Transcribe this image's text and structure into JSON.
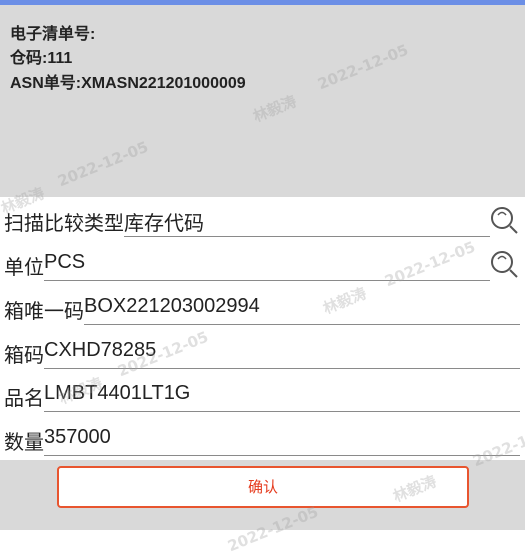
{
  "header": {
    "doc_no_label": "电子清单号:",
    "warehouse": "仓码:111",
    "asn": "ASN单号:XMASN221201000009"
  },
  "form": {
    "rows": [
      {
        "label": "扫描比较类型",
        "value": "库存代码",
        "icon": "search-icon"
      },
      {
        "label": "单位",
        "value": "PCS",
        "icon": "search-icon"
      },
      {
        "label": "箱唯一码",
        "value": "BOX221203002994"
      },
      {
        "label": "箱码",
        "value": "CXHD78285"
      },
      {
        "label": "品名",
        "value": "LMBT4401LT1G"
      },
      {
        "label": "数量",
        "value": "357000"
      }
    ]
  },
  "confirm_label": "确认",
  "watermark": {
    "name": "林毅涛",
    "date": "2022-12-05"
  },
  "colors": {
    "header_bg": "#d9d9d9",
    "top_accent": "#6c8fe6",
    "confirm_border": "#e8552f",
    "confirm_text": "#e53b1e"
  }
}
